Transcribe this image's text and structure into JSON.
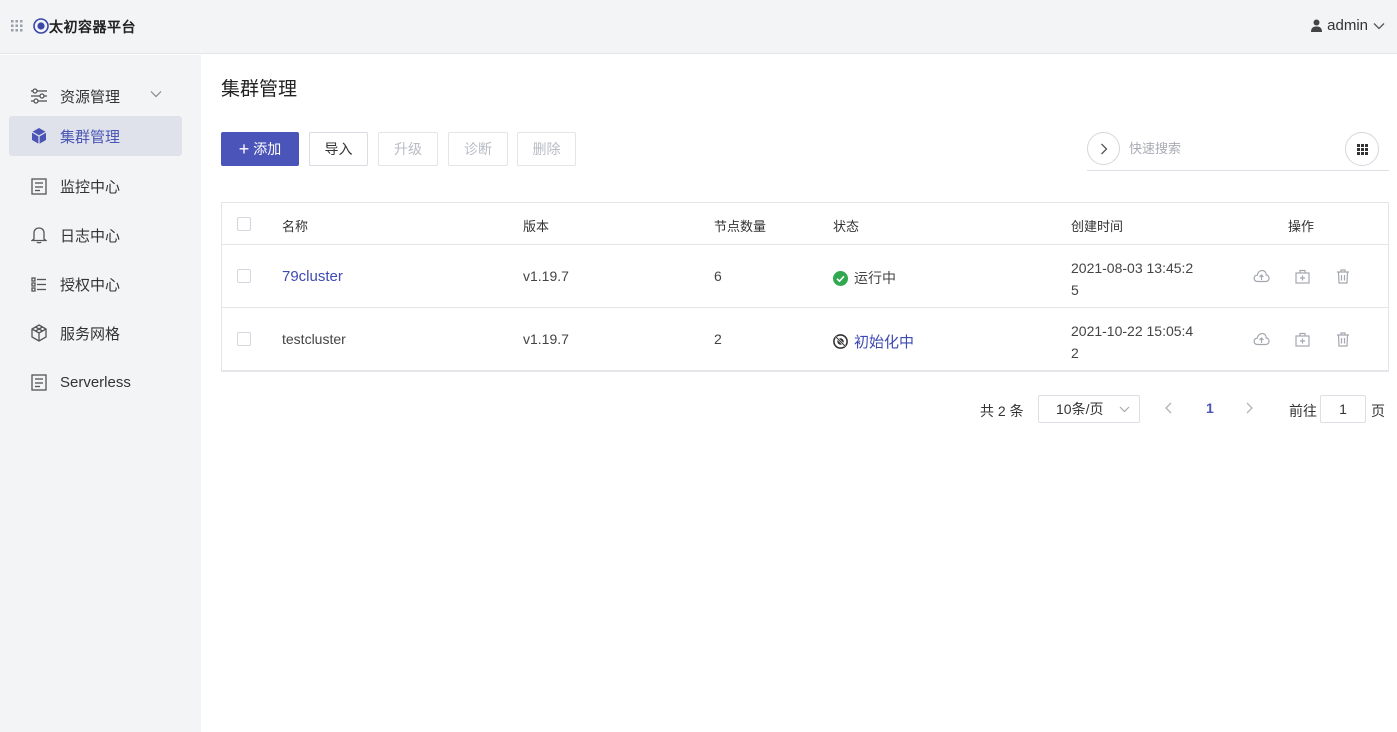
{
  "app": {
    "brand": "太初容器平台",
    "user": "admin"
  },
  "sidebar": {
    "items": [
      {
        "label": "资源管理",
        "icon": "sliders-icon"
      },
      {
        "label": "集群管理",
        "icon": "cube-icon"
      },
      {
        "label": "监控中心",
        "icon": "monitor-doc-icon"
      },
      {
        "label": "日志中心",
        "icon": "bell-icon"
      },
      {
        "label": "授权中心",
        "icon": "list-icon"
      },
      {
        "label": "服务网格",
        "icon": "hexagon-icon"
      },
      {
        "label": "Serverless",
        "icon": "doc-icon"
      }
    ]
  },
  "page": {
    "title": "集群管理"
  },
  "toolbar": {
    "add_label": "添加",
    "import_label": "导入",
    "upgrade_label": "升级",
    "diagnose_label": "诊断",
    "delete_label": "删除"
  },
  "search": {
    "placeholder": "快速搜索"
  },
  "table": {
    "columns": [
      "名称",
      "版本",
      "节点数量",
      "状态",
      "创建时间",
      "操作"
    ],
    "rows": [
      {
        "name": "79cluster",
        "version": "v1.19.7",
        "nodes": "6",
        "status": "运行中",
        "created_line1": "2021-08-03 13:45:2",
        "created_line2": "5"
      },
      {
        "name": "testcluster",
        "version": "v1.19.7",
        "nodes": "2",
        "status": "初始化中",
        "created_line1": "2021-10-22 15:05:4",
        "created_line2": "2"
      }
    ]
  },
  "pagination": {
    "total": "共 2 条",
    "page_size": "10条/页",
    "current": "1",
    "goto_label": "前往",
    "goto_value": "1",
    "goto_suffix": "页"
  },
  "colors": {
    "primary": "#4b54b8",
    "success": "#2fa84f",
    "link": "#3d4ab0"
  }
}
